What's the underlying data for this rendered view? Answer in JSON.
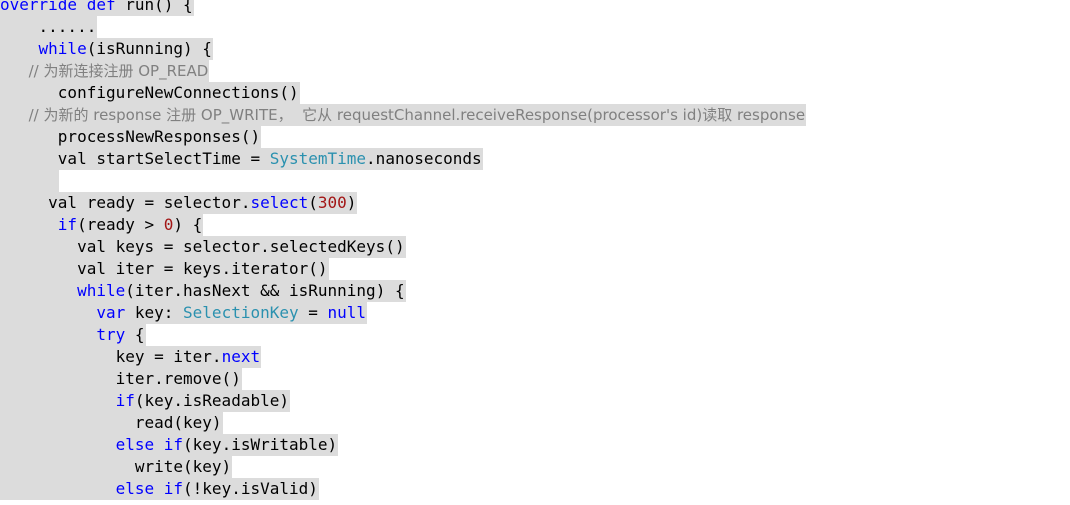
{
  "lines": [
    {
      "tokens": [
        {
          "t": "override def",
          "c": "kw"
        },
        {
          "t": " run() {",
          "c": "pl"
        }
      ]
    },
    {
      "tokens": [
        {
          "t": "    ......",
          "c": "pl"
        }
      ]
    },
    {
      "tokens": [
        {
          "t": "    ",
          "c": "pl"
        },
        {
          "t": "while",
          "c": "kw"
        },
        {
          "t": "(isRunning) {",
          "c": "pl"
        }
      ]
    },
    {
      "tokens": [
        {
          "t": "      // 为新连接注册 OP_READ",
          "c": "cm"
        }
      ]
    },
    {
      "tokens": [
        {
          "t": "      configureNewConnections()",
          "c": "pl"
        }
      ]
    },
    {
      "tokens": [
        {
          "t": "      // 为新的 response 注册 OP_WRITE，  它从 requestChannel.receiveResponse(processor's id)读取 response",
          "c": "cm"
        }
      ]
    },
    {
      "tokens": [
        {
          "t": "      processNewResponses()",
          "c": "pl"
        }
      ]
    },
    {
      "tokens": [
        {
          "t": "      val startSelectTime = ",
          "c": "pl"
        },
        {
          "t": "SystemTime",
          "c": "ty"
        },
        {
          "t": ".nanoseconds",
          "c": "pl"
        }
      ]
    },
    {
      "tokens": [
        {
          "t": "      ",
          "c": "pl"
        }
      ]
    },
    {
      "tokens": [
        {
          "t": "     val ready = selector.",
          "c": "pl"
        },
        {
          "t": "select",
          "c": "kw"
        },
        {
          "t": "(",
          "c": "pl"
        },
        {
          "t": "300",
          "c": "nm"
        },
        {
          "t": ")",
          "c": "pl"
        }
      ]
    },
    {
      "tokens": [
        {
          "t": "      ",
          "c": "pl"
        },
        {
          "t": "if",
          "c": "kw"
        },
        {
          "t": "(ready > ",
          "c": "pl"
        },
        {
          "t": "0",
          "c": "nm"
        },
        {
          "t": ") {",
          "c": "pl"
        }
      ]
    },
    {
      "tokens": [
        {
          "t": "        val keys = selector.selectedKeys()",
          "c": "pl"
        }
      ]
    },
    {
      "tokens": [
        {
          "t": "        val iter = keys.iterator()",
          "c": "pl"
        }
      ]
    },
    {
      "tokens": [
        {
          "t": "        ",
          "c": "pl"
        },
        {
          "t": "while",
          "c": "kw"
        },
        {
          "t": "(iter.hasNext && isRunning) {",
          "c": "pl"
        }
      ]
    },
    {
      "tokens": [
        {
          "t": "          ",
          "c": "pl"
        },
        {
          "t": "var",
          "c": "kw"
        },
        {
          "t": " key: ",
          "c": "pl"
        },
        {
          "t": "SelectionKey",
          "c": "ty"
        },
        {
          "t": " = ",
          "c": "pl"
        },
        {
          "t": "null",
          "c": "kw"
        }
      ]
    },
    {
      "tokens": [
        {
          "t": "          ",
          "c": "pl"
        },
        {
          "t": "try",
          "c": "kw"
        },
        {
          "t": " {",
          "c": "pl"
        }
      ]
    },
    {
      "tokens": [
        {
          "t": "            key = iter.",
          "c": "pl"
        },
        {
          "t": "next",
          "c": "kw"
        }
      ]
    },
    {
      "tokens": [
        {
          "t": "            iter.remove()",
          "c": "pl"
        }
      ]
    },
    {
      "tokens": [
        {
          "t": "            ",
          "c": "pl"
        },
        {
          "t": "if",
          "c": "kw"
        },
        {
          "t": "(key.isReadable)",
          "c": "pl"
        }
      ]
    },
    {
      "tokens": [
        {
          "t": "              read(key)",
          "c": "pl"
        }
      ]
    },
    {
      "tokens": [
        {
          "t": "            ",
          "c": "pl"
        },
        {
          "t": "else if",
          "c": "kw"
        },
        {
          "t": "(key.isWritable)",
          "c": "pl"
        }
      ]
    },
    {
      "tokens": [
        {
          "t": "              write(key)",
          "c": "pl"
        }
      ]
    },
    {
      "tokens": [
        {
          "t": "            ",
          "c": "pl"
        },
        {
          "t": "else if",
          "c": "kw"
        },
        {
          "t": "(!key.isValid)",
          "c": "pl"
        }
      ]
    }
  ]
}
